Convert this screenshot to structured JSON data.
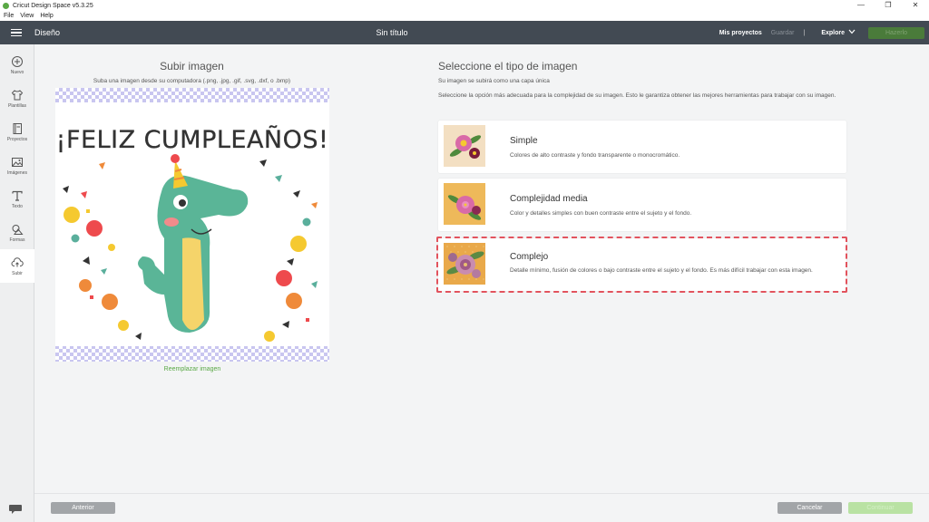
{
  "window": {
    "title": "Cricut Design Space  v5.3.25",
    "controls": [
      "—",
      "❐",
      "✕"
    ]
  },
  "menu": [
    "File",
    "View",
    "Help"
  ],
  "header": {
    "section": "Diseño",
    "doc_title": "Sin título",
    "my_projects": "Mis proyectos",
    "save": "Guardar",
    "separator": "|",
    "explore": "Explore",
    "make_it": "Hazerlo"
  },
  "sidebar": {
    "items": [
      {
        "label": "Nuevo",
        "icon": "plus-circle-icon"
      },
      {
        "label": "Plantillas",
        "icon": "shirt-icon"
      },
      {
        "label": "Proyectos",
        "icon": "book-icon"
      },
      {
        "label": "Imágenes",
        "icon": "image-icon"
      },
      {
        "label": "Texto",
        "icon": "text-t-icon"
      },
      {
        "label": "Formas",
        "icon": "shapes-icon"
      },
      {
        "label": "Subir",
        "icon": "upload-cloud-icon"
      }
    ],
    "active": "Subir"
  },
  "upload": {
    "title": "Subir imagen",
    "description": "Suba una imagen desde su computadora (.png, .jpg, .gif, .svg, .dxf, o .bmp)",
    "image_text": "¡FELIZ CUMPLEAÑOS!",
    "replace_link": "Reemplazar imagen"
  },
  "image_type": {
    "title": "Seleccione el tipo de imagen",
    "subtitle": "Su imagen se subirá como una capa única",
    "description": "Seleccione la opción más adecuada para la complejidad de su imagen. Esto le garantiza obtener las mejores herramientas para trabajar con su imagen.",
    "options": [
      {
        "name": "Simple",
        "desc": "Colores de alto contraste y fondo transparente o monocromático.",
        "thumb_bg": "#f3dfc2"
      },
      {
        "name": "Complejidad media",
        "desc": "Color y detalles simples con buen contraste entre el sujeto y el fondo.",
        "thumb_bg": "#eeb95a"
      },
      {
        "name": "Complejo",
        "desc": "Detalle mínimo, fusión de colores o bajo contraste entre el sujeto y el fondo. Es más difícil trabajar con esta imagen.",
        "thumb_bg": "#e9a94a"
      }
    ],
    "selected": "Complejo",
    "highlight_color": "#e2535d"
  },
  "footer": {
    "previous": "Anterior",
    "cancel": "Cancelar",
    "continue": "Continuar"
  },
  "colors": {
    "header_bg": "#424a53",
    "accent_green": "#59a845"
  }
}
